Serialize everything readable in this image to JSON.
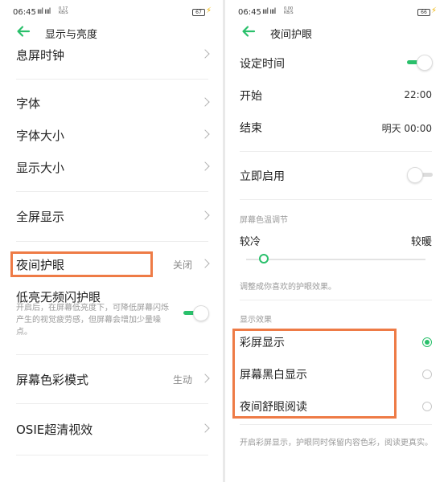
{
  "colors": {
    "accent": "#2ac06b",
    "highlight": "#ee7b46"
  },
  "left": {
    "status": {
      "time": "06:45",
      "signal": "ıııl ıııl",
      "net": "0.17\nKB/S",
      "battery": "67"
    },
    "title": "显示与亮度",
    "items": {
      "aod_clock": "息屏时钟",
      "font": "字体",
      "font_size": "字体大小",
      "display_size": "显示大小",
      "fullscreen": "全屏显示",
      "night_mode": "夜间护眼",
      "night_mode_value": "关闭",
      "low_flicker": "低亮无频闪护眼",
      "low_flicker_desc": "开启后，在屏幕低亮度下，可降低屏幕闪烁产生的视觉疲劳感，但屏幕会增加少量噪点。",
      "color_mode": "屏幕色彩模式",
      "color_mode_value": "生动",
      "osie": "OSIE超清视效"
    },
    "toggles": {
      "low_flicker_on": true
    }
  },
  "right": {
    "status": {
      "time": "06:45",
      "signal": "ıııl ıııl",
      "net": "0.00\nKB/S",
      "battery": "66"
    },
    "title": "夜间护眼",
    "schedule": "设定时间",
    "start_label": "开始",
    "start_value": "22:00",
    "end_label": "结束",
    "end_value": "明天 00:00",
    "enable_now": "立即启用",
    "temp_section": "屏幕色温调节",
    "cooler": "较冷",
    "warmer": "较暖",
    "temp_level": 0.1,
    "temp_desc": "调整成你喜欢的护眼效果。",
    "effect_section": "显示效果",
    "effects": [
      "彩屏显示",
      "屏幕黑白显示",
      "夜间舒眼阅读"
    ],
    "selected_effect": 0,
    "effect_desc": "开启彩屏显示，护眼同时保留内容色彩，阅读更真实。",
    "toggles": {
      "schedule_on": true,
      "enable_now_on": false
    }
  }
}
